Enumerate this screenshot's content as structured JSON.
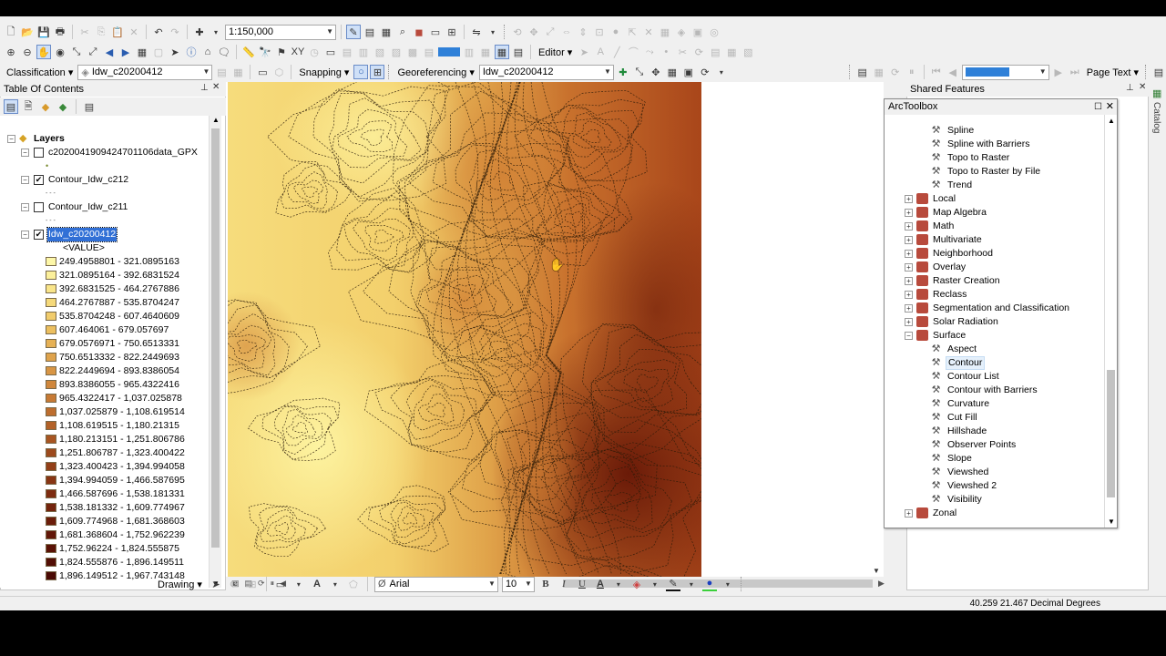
{
  "toolbar1": {
    "scale": "1:150,000"
  },
  "toolbar2": {
    "editor_label": "Editor ▾"
  },
  "toolbar3": {
    "classification_label": "Classification ▾",
    "classification_layer": "Idw_c20200412",
    "snapping_label": "Snapping ▾",
    "georeferencing_label": "Georeferencing ▾",
    "georef_layer": "Idw_c20200412",
    "page_text_label": "Page Text ▾"
  },
  "toc": {
    "title": "Table Of Contents",
    "root_label": "Layers",
    "layers": [
      {
        "label": "c202004190942470110​6data_GPX",
        "checked": false
      },
      {
        "label": "Contour_Idw_c212",
        "checked": true
      },
      {
        "label": "Contour_Idw_c211",
        "checked": false
      },
      {
        "label": "Idw_c20200412",
        "checked": true,
        "selected": true
      }
    ],
    "value_label": "<VALUE>",
    "classes": [
      {
        "range": "249.4958801 - 321.0895163",
        "color": "#fdf7a8"
      },
      {
        "range": "321.0895164 - 392.6831524",
        "color": "#fcf09b"
      },
      {
        "range": "392.6831525 - 464.2767886",
        "color": "#f9e58a"
      },
      {
        "range": "464.2767887 - 535.8704247",
        "color": "#f5d97a"
      },
      {
        "range": "535.8704248 - 607.4640609",
        "color": "#f1cc6c"
      },
      {
        "range": "607.464061 - 679.057697",
        "color": "#ecbf5f"
      },
      {
        "range": "679.0576971 - 750.6513331",
        "color": "#e6b155"
      },
      {
        "range": "750.6513332 - 822.2449693",
        "color": "#dfa34c"
      },
      {
        "range": "822.2449694 - 893.8386054",
        "color": "#d89544"
      },
      {
        "range": "893.8386055 - 965.4322416",
        "color": "#d0873c"
      },
      {
        "range": "965.4322417 - 1,037.025878",
        "color": "#c77a35"
      },
      {
        "range": "1,037.025879 - 1,108.619514",
        "color": "#bd6d2e"
      },
      {
        "range": "1,108.619515 - 1,180.21315",
        "color": "#b36128"
      },
      {
        "range": "1,180.213151 - 1,251.806786",
        "color": "#a85522"
      },
      {
        "range": "1,251.806787 - 1,323.400422",
        "color": "#9d4a1d"
      },
      {
        "range": "1,323.400423 - 1,394.994058",
        "color": "#933f18"
      },
      {
        "range": "1,394.994059 - 1,466.587695",
        "color": "#883514"
      },
      {
        "range": "1,466.587696 - 1,538.181331",
        "color": "#7e2c10"
      },
      {
        "range": "1,538.181332 - 1,609.774967",
        "color": "#74240d"
      },
      {
        "range": "1,609.774968 - 1,681.368603",
        "color": "#6b1d0a"
      },
      {
        "range": "1,681.368604 - 1,752.962239",
        "color": "#621708"
      },
      {
        "range": "1,752.96224 - 1,824.555875",
        "color": "#5a1206"
      },
      {
        "range": "1,824.555876 - 1,896.149511",
        "color": "#520e05"
      },
      {
        "range": "1,896.149512 - 1,967.743148",
        "color": "#4a0a04"
      }
    ]
  },
  "shared_features": {
    "title": "Shared Features"
  },
  "arctoolbox": {
    "title": "ArcToolbox",
    "items": [
      {
        "label": "Spline",
        "kind": "tool"
      },
      {
        "label": "Spline with Barriers",
        "kind": "tool"
      },
      {
        "label": "Topo to Raster",
        "kind": "tool"
      },
      {
        "label": "Topo to Raster by File",
        "kind": "tool"
      },
      {
        "label": "Trend",
        "kind": "tool"
      },
      {
        "label": "Local",
        "kind": "toolset"
      },
      {
        "label": "Map Algebra",
        "kind": "toolset"
      },
      {
        "label": "Math",
        "kind": "toolset"
      },
      {
        "label": "Multivariate",
        "kind": "toolset"
      },
      {
        "label": "Neighborhood",
        "kind": "toolset"
      },
      {
        "label": "Overlay",
        "kind": "toolset"
      },
      {
        "label": "Raster Creation",
        "kind": "toolset"
      },
      {
        "label": "Reclass",
        "kind": "toolset"
      },
      {
        "label": "Segmentation and Classification",
        "kind": "toolset"
      },
      {
        "label": "Solar Radiation",
        "kind": "toolset"
      },
      {
        "label": "Surface",
        "kind": "toolset-open"
      },
      {
        "label": "Aspect",
        "kind": "tool"
      },
      {
        "label": "Contour",
        "kind": "tool",
        "hover": true
      },
      {
        "label": "Contour List",
        "kind": "tool"
      },
      {
        "label": "Contour with Barriers",
        "kind": "tool"
      },
      {
        "label": "Curvature",
        "kind": "tool"
      },
      {
        "label": "Cut Fill",
        "kind": "tool"
      },
      {
        "label": "Hillshade",
        "kind": "tool"
      },
      {
        "label": "Observer Points",
        "kind": "tool"
      },
      {
        "label": "Slope",
        "kind": "tool"
      },
      {
        "label": "Viewshed",
        "kind": "tool"
      },
      {
        "label": "Viewshed 2",
        "kind": "tool"
      },
      {
        "label": "Visibility",
        "kind": "tool"
      },
      {
        "label": "Zonal",
        "kind": "toolset"
      }
    ]
  },
  "drawing": {
    "drawing_label": "Drawing ▾",
    "font_name": "Arial",
    "font_size": "10",
    "bold": "B",
    "italic": "I",
    "underline": "U"
  },
  "status": {
    "coords": "40.259  21.467 Decimal Degrees"
  },
  "right_strip": {
    "catalog_label": "Catalog"
  }
}
